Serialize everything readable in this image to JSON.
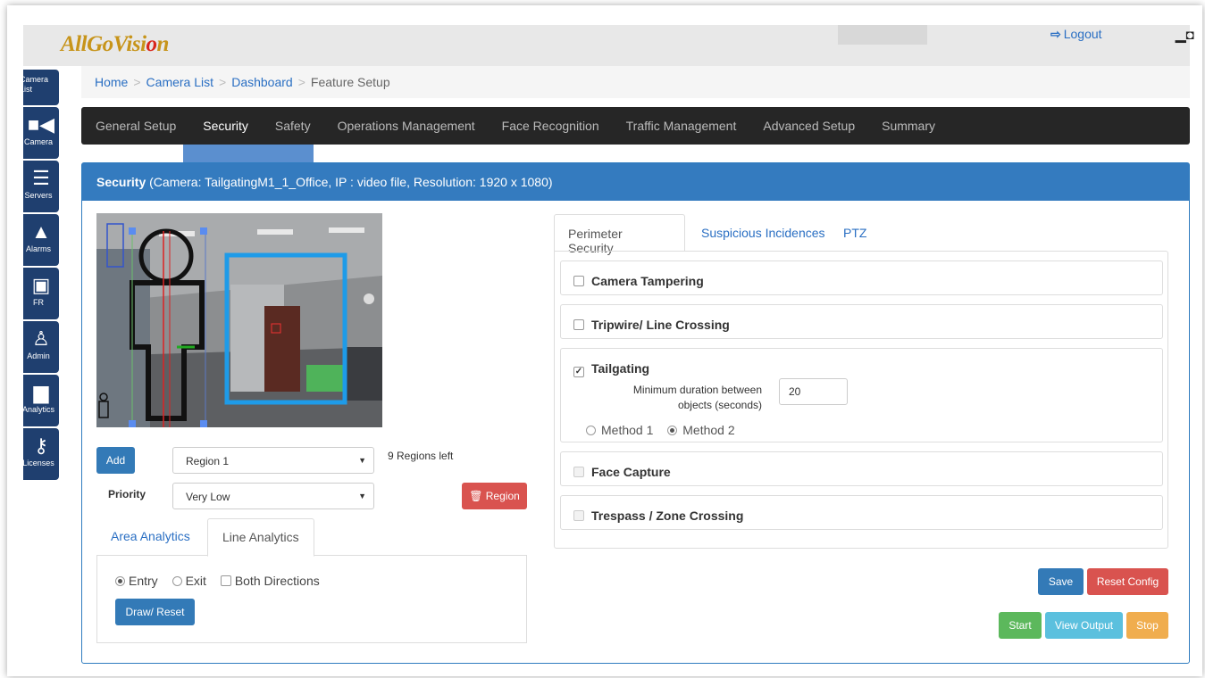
{
  "header": {
    "logo_prefix": "AllGoVisi",
    "logo_o": "o",
    "logo_suffix": "n",
    "logout_label": "Logout"
  },
  "leftnav": {
    "items": [
      {
        "label": "Camera List",
        "icon": "list-icon"
      },
      {
        "label": "Camera",
        "icon": "video-camera-icon"
      },
      {
        "label": "Servers",
        "icon": "server-icon"
      },
      {
        "label": "Alarms",
        "icon": "bell-icon"
      },
      {
        "label": "FR",
        "icon": "id-card-icon"
      },
      {
        "label": "Admin",
        "icon": "user-icon"
      },
      {
        "label": "Analytics",
        "icon": "bar-chart-icon"
      },
      {
        "label": "Licenses",
        "icon": "key-icon"
      }
    ]
  },
  "breadcrumb": {
    "home": "Home",
    "camera_list": "Camera List",
    "dashboard": "Dashboard",
    "current": "Feature Setup",
    "separator": ">"
  },
  "mainnav": {
    "tabs": [
      "General Setup",
      "Security",
      "Safety",
      "Operations Management",
      "Face Recognition",
      "Traffic Management",
      "Advanced Setup",
      "Summary"
    ],
    "active": "Security"
  },
  "panel": {
    "title": "Security",
    "subtitle": "(Camera: TailgatingM1_1_Office, IP : video file, Resolution: 1920 x 1080)"
  },
  "regions": {
    "add_label": "Add",
    "region_value": "Region 1",
    "regions_left": "9 Regions left",
    "priority_label": "Priority",
    "priority_value": "Very Low",
    "delete_region_label": "Region"
  },
  "analytics_tabs": {
    "area": "Area Analytics",
    "line": "Line Analytics",
    "entry": "Entry",
    "exit": "Exit",
    "both": "Both Directions",
    "draw_reset": "Draw/ Reset"
  },
  "right_tabs": {
    "perimeter": "Perimeter Security",
    "suspicious": "Suspicious Incidences",
    "ptz": "PTZ"
  },
  "features": {
    "camera_tampering": "Camera Tampering",
    "tripwire": "Tripwire/ Line Crossing",
    "tailgating": "Tailgating",
    "duration_label_1": "Minimum duration between",
    "duration_label_2": "objects (seconds)",
    "duration_value": "20",
    "method1": "Method 1",
    "method2": "Method 2",
    "face_capture": "Face Capture",
    "trespass": "Trespass / Zone Crossing"
  },
  "actions": {
    "save": "Save",
    "reset_config": "Reset Config",
    "start": "Start",
    "view_output": "View Output",
    "stop": "Stop"
  },
  "colors": {
    "primary": "#337ab7",
    "danger": "#d9534f",
    "success": "#5cb85c",
    "info": "#5bc0de",
    "warning": "#f0ad4e",
    "nav": "#1f3f6f",
    "tabbar": "#262626"
  }
}
